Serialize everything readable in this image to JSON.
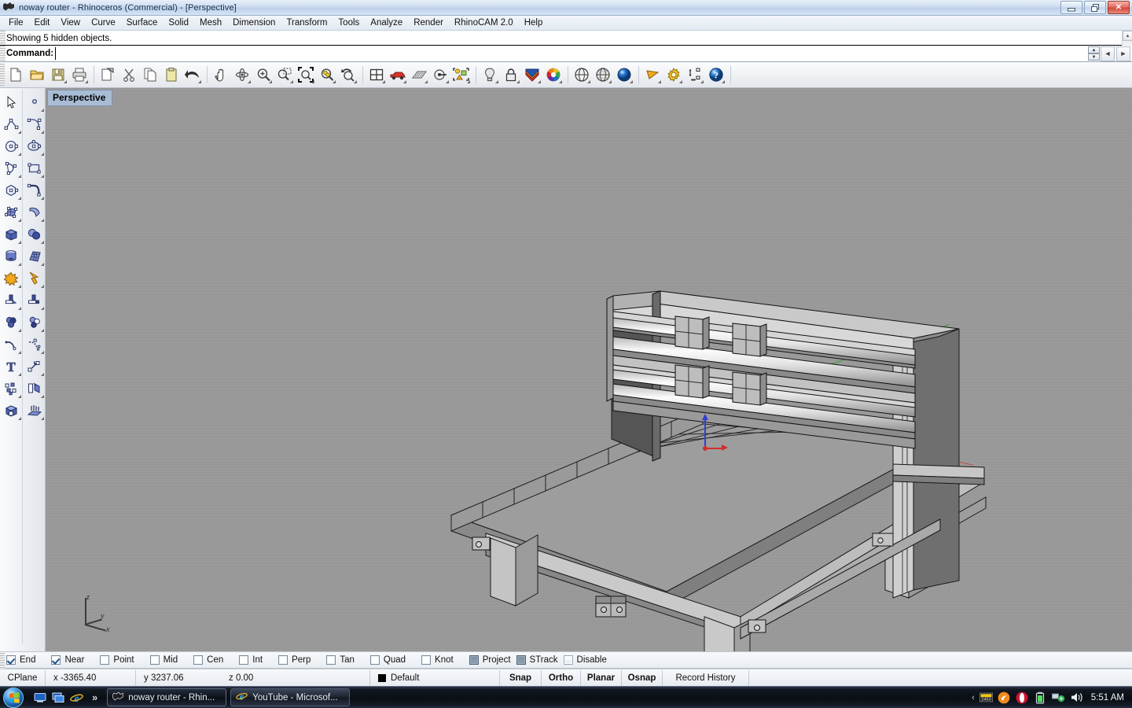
{
  "window": {
    "title": "noway router - Rhinoceros (Commercial) - [Perspective]",
    "icon": "rhino-icon",
    "minimize_label": "Minimize",
    "maximize_label": "Restore",
    "close_label": "Close"
  },
  "menubar": {
    "items": [
      {
        "label": "File"
      },
      {
        "label": "Edit"
      },
      {
        "label": "View"
      },
      {
        "label": "Curve"
      },
      {
        "label": "Surface"
      },
      {
        "label": "Solid"
      },
      {
        "label": "Mesh"
      },
      {
        "label": "Dimension"
      },
      {
        "label": "Transform"
      },
      {
        "label": "Tools"
      },
      {
        "label": "Analyze"
      },
      {
        "label": "Render"
      },
      {
        "label": "RhinoCAM 2.0"
      },
      {
        "label": "Help"
      }
    ]
  },
  "command": {
    "history_line": "Showing 5 hidden objects.",
    "prompt_label": "Command:",
    "input_value": "",
    "input_placeholder": ""
  },
  "toolbar": {
    "buttons": [
      {
        "name": "new-file-icon",
        "tip": "New"
      },
      {
        "name": "open-file-icon",
        "tip": "Open"
      },
      {
        "name": "save-file-icon",
        "tip": "Save"
      },
      {
        "name": "print-icon",
        "tip": "Print"
      },
      {
        "name": "copy-to-clipboard-icon",
        "tip": "Copy to clipboard"
      },
      {
        "name": "cut-icon",
        "tip": "Cut"
      },
      {
        "name": "copy-icon",
        "tip": "Copy"
      },
      {
        "name": "paste-icon",
        "tip": "Paste"
      },
      {
        "name": "undo-icon",
        "tip": "Undo"
      },
      {
        "name": "pan-icon",
        "tip": "Pan"
      },
      {
        "name": "rotate-view-icon",
        "tip": "Rotate view"
      },
      {
        "name": "zoom-in-icon",
        "tip": "Zoom in"
      },
      {
        "name": "zoom-window-icon",
        "tip": "Zoom window"
      },
      {
        "name": "zoom-extents-icon",
        "tip": "Zoom extents"
      },
      {
        "name": "zoom-selected-icon",
        "tip": "Zoom selected"
      },
      {
        "name": "zoom-previous-icon",
        "tip": "Zoom previous"
      },
      {
        "name": "four-viewport-icon",
        "tip": "Viewport layout"
      },
      {
        "name": "object-snap-car-icon",
        "tip": "Object properties"
      },
      {
        "name": "grid-plane-icon",
        "tip": "CPlane"
      },
      {
        "name": "select-object-icon",
        "tip": "Select objects"
      },
      {
        "name": "select-by-type-icon",
        "tip": "Select by type"
      },
      {
        "name": "light-bulb-icon",
        "tip": "Lights"
      },
      {
        "name": "lock-icon",
        "tip": "Lock object"
      },
      {
        "name": "layers-icon",
        "tip": "Layers"
      },
      {
        "name": "color-wheel-icon",
        "tip": "Object color"
      },
      {
        "name": "shade-sphere-icon",
        "tip": "Shade"
      },
      {
        "name": "render-preview-icon",
        "tip": "Render preview"
      },
      {
        "name": "ghosted-sphere-icon",
        "tip": "Ghosted view"
      },
      {
        "name": "rendered-sphere-icon",
        "tip": "Rendered view"
      },
      {
        "name": "flat-shade-icon",
        "tip": "Flat shade"
      },
      {
        "name": "options-gear-icon",
        "tip": "Options"
      },
      {
        "name": "dimension-icon",
        "tip": "Dimension"
      },
      {
        "name": "help-icon",
        "tip": "Help"
      }
    ]
  },
  "sidebar": {
    "buttons": [
      {
        "name": "select-arrow-icon"
      },
      {
        "name": "point-object-icon"
      },
      {
        "name": "polyline-icon"
      },
      {
        "name": "curve-through-points-icon"
      },
      {
        "name": "circle-icon"
      },
      {
        "name": "ellipse-icon"
      },
      {
        "name": "arc-icon"
      },
      {
        "name": "rectangle-icon"
      },
      {
        "name": "polygon-icon"
      },
      {
        "name": "fillet-curve-icon"
      },
      {
        "name": "surface-from-curves-icon"
      },
      {
        "name": "surface-sweep-icon"
      },
      {
        "name": "box-solid-icon"
      },
      {
        "name": "boolean-union-icon"
      },
      {
        "name": "cylinder-icon"
      },
      {
        "name": "mesh-icon"
      },
      {
        "name": "explode-icon"
      },
      {
        "name": "boolean-split-icon"
      },
      {
        "name": "trim-icon"
      },
      {
        "name": "split-icon"
      },
      {
        "name": "boolean-difference-icon"
      },
      {
        "name": "boolean-intersection-icon"
      },
      {
        "name": "offset-curve-icon"
      },
      {
        "name": "curve-from-object-icon"
      },
      {
        "name": "text-icon"
      },
      {
        "name": "scale-icon"
      },
      {
        "name": "array-icon"
      },
      {
        "name": "mirror-icon"
      },
      {
        "name": "cap-planar-holes-icon"
      },
      {
        "name": "extrude-icon"
      }
    ]
  },
  "viewport": {
    "label": "Perspective",
    "world_axes": {
      "x": "x",
      "y": "y",
      "z": "z"
    },
    "display_mode": "Shaded",
    "model": "CNC router gantry machine"
  },
  "osnap": {
    "items": [
      {
        "label": "End",
        "state": "checked",
        "type": "checkbox"
      },
      {
        "label": "Near",
        "state": "checked",
        "type": "checkbox"
      },
      {
        "label": "Point",
        "state": "unchecked",
        "type": "checkbox"
      },
      {
        "label": "Mid",
        "state": "unchecked",
        "type": "checkbox"
      },
      {
        "label": "Cen",
        "state": "unchecked",
        "type": "checkbox"
      },
      {
        "label": "Int",
        "state": "unchecked",
        "type": "checkbox"
      },
      {
        "label": "Perp",
        "state": "unchecked",
        "type": "checkbox"
      },
      {
        "label": "Tan",
        "state": "unchecked",
        "type": "checkbox"
      },
      {
        "label": "Quad",
        "state": "unchecked",
        "type": "checkbox"
      },
      {
        "label": "Knot",
        "state": "unchecked",
        "type": "checkbox"
      },
      {
        "label": "Project",
        "state": "pressed",
        "type": "button"
      },
      {
        "label": "STrack",
        "state": "pressed",
        "type": "button"
      },
      {
        "label": "Disable",
        "state": "raised",
        "type": "button"
      }
    ]
  },
  "statusbar": {
    "cplane_label": "CPlane",
    "x_value": "x -3365.40",
    "y_value": "y 3237.06",
    "z_value": "z 0.00",
    "layer_name": "Default",
    "layer_color": "#000000",
    "toggles": [
      {
        "label": "Snap",
        "bold": true
      },
      {
        "label": "Ortho",
        "bold": true
      },
      {
        "label": "Planar",
        "bold": true
      },
      {
        "label": "Osnap",
        "bold": true
      },
      {
        "label": "Record History",
        "bold": false
      }
    ]
  },
  "taskbar": {
    "start_label": "Start",
    "quick_launch": [
      {
        "name": "show-desktop-icon"
      },
      {
        "name": "switch-window-icon"
      },
      {
        "name": "internet-explorer-icon"
      }
    ],
    "overflow_chevron": "»",
    "tasks": [
      {
        "label": "noway router - Rhin...",
        "icon": "rhino-icon",
        "active": true
      },
      {
        "label": "YouTube - Microsof...",
        "icon": "internet-explorer-icon",
        "active": false
      }
    ],
    "tray": {
      "chevron": "‹",
      "icons": [
        {
          "name": "counter-2450-icon",
          "label": "2450"
        },
        {
          "name": "orange-circle-icon"
        },
        {
          "name": "opera-icon"
        },
        {
          "name": "battery-icon"
        },
        {
          "name": "network-icon"
        },
        {
          "name": "volume-icon"
        }
      ],
      "clock": "5:51 AM"
    }
  }
}
